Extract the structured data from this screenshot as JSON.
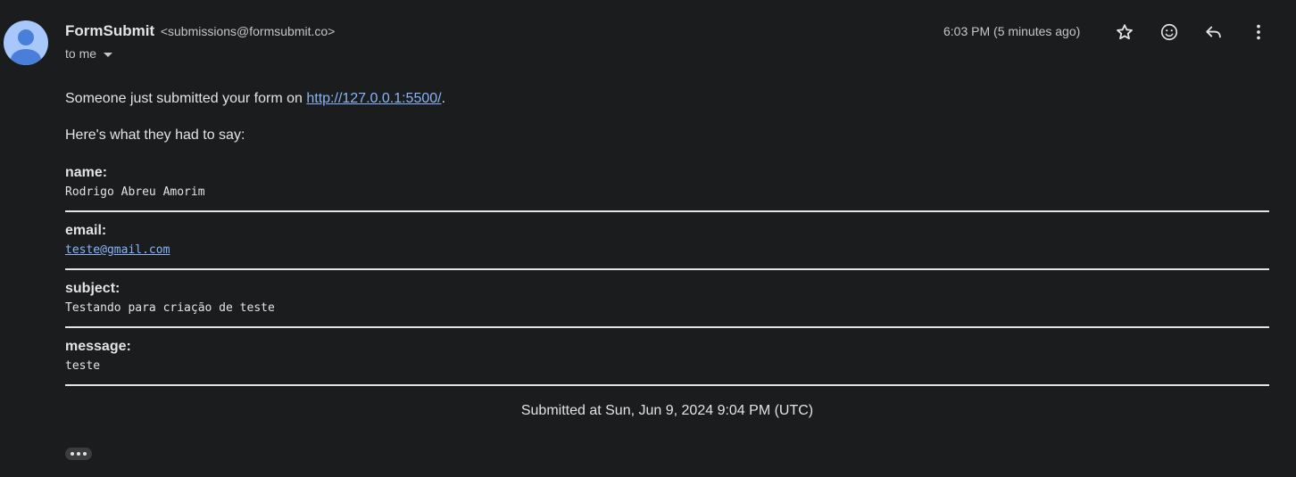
{
  "header": {
    "sender_name": "FormSubmit",
    "sender_email": "<submissions@formsubmit.co>",
    "recipient": "to me",
    "time": "6:03 PM (5 minutes ago)",
    "icons": [
      "star-icon",
      "emoji-icon",
      "reply-icon",
      "more-vert-icon"
    ]
  },
  "body": {
    "intro_prefix": "Someone just submitted your form on ",
    "intro_link": "http://127.0.0.1:5500/",
    "intro_suffix": ".",
    "lead": "Here's what they had to say:",
    "fields": [
      {
        "label": "name:",
        "value": "Rodrigo Abreu Amorim"
      },
      {
        "label": "email:",
        "value": "teste@gmail.com"
      },
      {
        "label": "subject:",
        "value": "Testando para criação de teste"
      },
      {
        "label": "message:",
        "value": "teste"
      }
    ],
    "footer": "Submitted at Sun, Jun 9, 2024 9:04 PM (UTC)"
  },
  "colors": {
    "background": "#1b1c1e",
    "text": "#e3e3e3",
    "link": "#8ab4f8",
    "avatar": "#a8c7fa"
  }
}
